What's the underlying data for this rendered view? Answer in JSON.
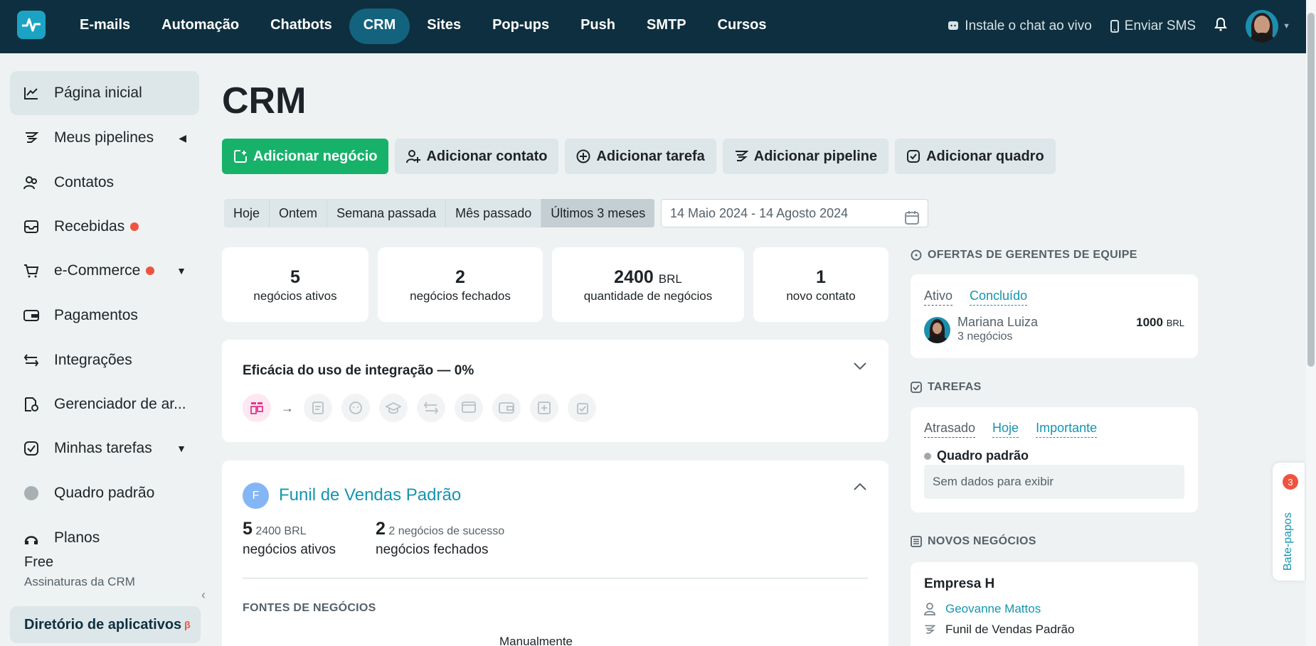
{
  "topnav": {
    "items": [
      "E-mails",
      "Automação",
      "Chatbots",
      "CRM",
      "Sites",
      "Pop-ups",
      "Push",
      "SMTP",
      "Cursos"
    ],
    "active": "CRM"
  },
  "topright": {
    "chat_link": "Instale o chat ao vivo",
    "sms_link": "Enviar SMS"
  },
  "sidebar": {
    "items": [
      {
        "label": "Página inicial",
        "icon": "chart-line-icon"
      },
      {
        "label": "Meus pipelines",
        "icon": "pipeline-icon"
      },
      {
        "label": "Contatos",
        "icon": "contacts-icon"
      },
      {
        "label": "Recebidas",
        "icon": "inbox-icon"
      },
      {
        "label": "e-Commerce",
        "icon": "cart-icon"
      },
      {
        "label": "Pagamentos",
        "icon": "wallet-icon"
      },
      {
        "label": "Integrações",
        "icon": "swap-icon"
      },
      {
        "label": "Gerenciador de ar...",
        "icon": "file-manager-icon"
      },
      {
        "label": "Minhas tarefas",
        "icon": "task-check-icon"
      },
      {
        "label": "Quadro padrão",
        "icon": "gray-dot-icon"
      },
      {
        "label": "Planos",
        "icon": "plans-icon"
      }
    ],
    "plan": "Free",
    "plan_sub": "Assinaturas da CRM",
    "directory": "Diretório de aplicativos",
    "directory_badge": "β"
  },
  "page": {
    "title": "CRM"
  },
  "actions": {
    "add_deal": "Adicionar negócio",
    "add_contact": "Adicionar contato",
    "add_task": "Adicionar tarefa",
    "add_pipeline": "Adicionar pipeline",
    "add_board": "Adicionar quadro"
  },
  "ranges": {
    "items": [
      "Hoje",
      "Ontem",
      "Semana passada",
      "Mês passado",
      "Últimos 3 meses"
    ],
    "active": "Últimos 3 meses",
    "date_range": "14 Maio 2024 - 14 Agosto 2024"
  },
  "stats": [
    {
      "value": "5",
      "unit": "",
      "label": "negócios ativos"
    },
    {
      "value": "2",
      "unit": "",
      "label": "negócios fechados"
    },
    {
      "value": "2400",
      "unit": "BRL",
      "label": "quantidade de negócios"
    },
    {
      "value": "1",
      "unit": "",
      "label": "novo contato"
    }
  ],
  "efficiency": {
    "title": "Eficácia do uso de integração — 0%"
  },
  "funnel": {
    "initial": "F",
    "title": "Funil de Vendas Padrão",
    "active_count": "5",
    "active_amount": "2400 BRL",
    "active_label": "negócios ativos",
    "closed_count": "2",
    "closed_sub": "2 negócios de sucesso",
    "closed_label": "negócios fechados",
    "sources_title": "FONTES DE NEGÓCIOS",
    "source_manual": "Manualmente"
  },
  "managers": {
    "title": "OFERTAS DE GERENTES DE EQUIPE",
    "tabs": [
      "Ativo",
      "Concluído"
    ],
    "name": "Mariana Luiza",
    "deals": "3 negócios",
    "value": "1000",
    "currency": "BRL"
  },
  "tasks": {
    "title": "TAREFAS",
    "tabs": [
      "Atrasado",
      "Hoje",
      "Importante"
    ],
    "board": "Quadro padrão",
    "empty": "Sem dados para exibir"
  },
  "new_deals": {
    "title": "NOVOS NEGÓCIOS",
    "company": "Empresa H",
    "contact": "Geovanne Mattos",
    "pipeline": "Funil de Vendas Padrão"
  },
  "chat": {
    "label": "Bate-papos",
    "badge": "3"
  },
  "colors": {
    "topbar": "#0e2f3f",
    "accent": "#1495b1",
    "primary_button": "#17b26a",
    "badge": "#f0533d"
  }
}
